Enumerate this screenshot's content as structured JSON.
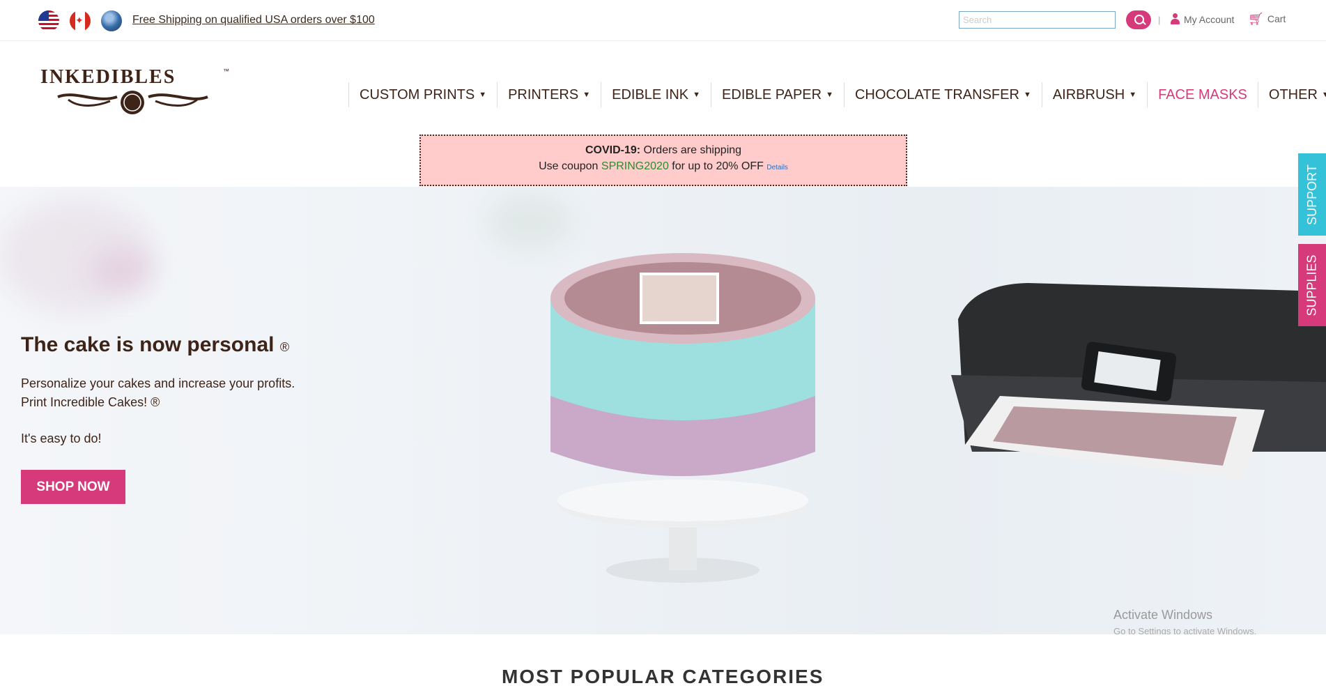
{
  "topbar": {
    "flags": [
      "us-flag-icon",
      "canada-flag-icon",
      "world-icon"
    ],
    "shipping_text": "Free Shipping on qualified USA orders over $100",
    "search_placeholder": "Search",
    "separator": "|",
    "my_account": "My Account",
    "cart": "Cart"
  },
  "logo": {
    "text": "INKEDIBLES",
    "tm": "™"
  },
  "nav": [
    {
      "label": "CUSTOM PRINTS",
      "dropdown": true
    },
    {
      "label": "PRINTERS",
      "dropdown": true
    },
    {
      "label": "EDIBLE INK",
      "dropdown": true
    },
    {
      "label": "EDIBLE PAPER",
      "dropdown": true
    },
    {
      "label": "CHOCOLATE TRANSFER",
      "dropdown": true
    },
    {
      "label": "AIRBRUSH",
      "dropdown": true
    },
    {
      "label": "FACE MASKS",
      "dropdown": false
    },
    {
      "label": "OTHER",
      "dropdown": true
    }
  ],
  "covid": {
    "title": "COVID-19:",
    "title_rest": " Orders are shipping",
    "coupon_prefix": "Use coupon ",
    "coupon_code": "SPRING2020",
    "coupon_suffix": " for up to 20% OFF",
    "details": "Details"
  },
  "hero": {
    "title": "The cake is now personal",
    "title_mark": "®",
    "line1": "Personalize your cakes and increase your profits.",
    "line2": "Print Incredible Cakes! ®",
    "line3": "It's easy to do!",
    "cta": "SHOP NOW"
  },
  "side_tabs": {
    "support": "SUPPORT",
    "supplies": "SUPPLIES"
  },
  "watermark": {
    "line1": "Activate Windows",
    "line2": "Go to Settings to activate Windows."
  },
  "next_section_title": "MOST POPULAR CATEGORIES",
  "colors": {
    "accent": "#d63a7a",
    "support": "#34c2d9",
    "brand_text": "#3e2418",
    "covid_bg": "#ffcccb"
  }
}
